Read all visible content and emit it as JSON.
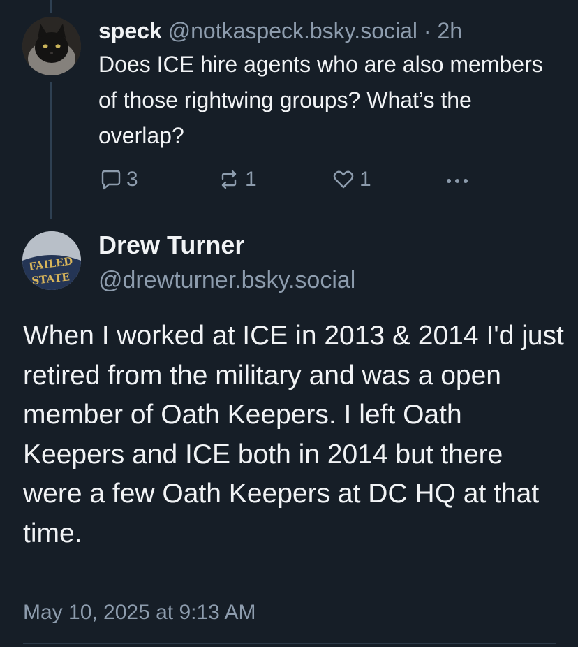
{
  "parent_post": {
    "display_name": "speck",
    "handle": "@notkaspeck.bsky.social",
    "separator": "·",
    "time_ago": "2h",
    "text": "Does ICE hire agents who are also members of those rightwing groups? What’s the overlap?",
    "reply_count": "3",
    "repost_count": "1",
    "like_count": "1",
    "reply_icon": "speech-bubble-icon",
    "repost_icon": "repost-arrows-icon",
    "like_icon": "heart-icon",
    "more_icon": "ellipsis-icon"
  },
  "main_post": {
    "display_name": "Drew Turner",
    "handle": "@drewturner.bsky.social",
    "text": "When I worked at ICE in 2013 & 2014 I'd just retired from the military and was a open member of Oath Keepers. I left Oath Keepers and ICE both in 2014 but there were a few Oath Keepers at DC HQ at that time.",
    "timestamp": "May 10, 2025 at 9:13 AM",
    "avatar_shirt_text": [
      "FAILED",
      "STATE"
    ]
  },
  "colors": {
    "background": "#161e27",
    "text": "#f1f3f5",
    "muted": "#8d9cad",
    "thread_line": "#2e4052"
  }
}
